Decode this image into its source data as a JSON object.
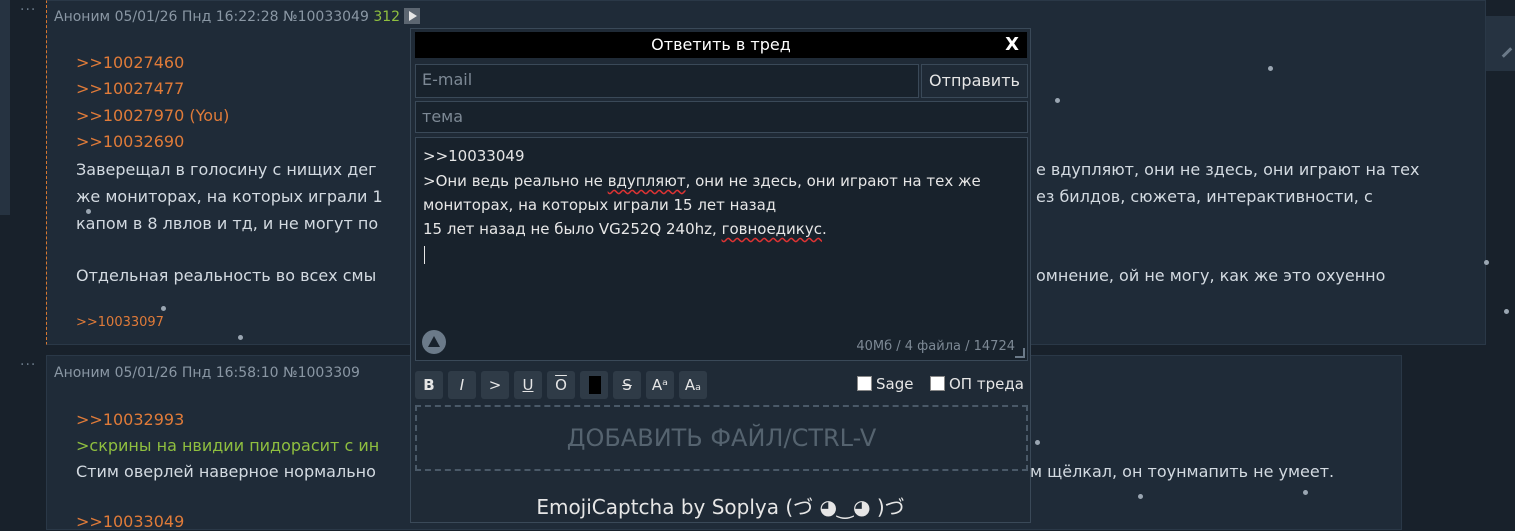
{
  "post1": {
    "author": "Аноним",
    "datetime": "05/01/26 Пнд 16:22:28",
    "number": "№10033049",
    "count": "312",
    "lines": [
      {
        "cls": "reply",
        "text": ">>10027460"
      },
      {
        "cls": "reply",
        "text": ">>10027477"
      },
      {
        "cls": "reply",
        "text": ">>10027970 (You)"
      },
      {
        "cls": "reply",
        "text": ">>10032690"
      }
    ],
    "body_line1_left": "Заверещал в голосину с нищих дег",
    "body_line1_right": "е вдупляют, они не здесь, они играют на тех",
    "body_line2_left": "же мониторах, на которых играли 1",
    "body_line2_right": "ез билдов, сюжета, интерактивности, с",
    "body_line3_left": "капом в 8 лвлов и тд, и не могут по",
    "body_line4_left": "Отдельная реальность во всех смы",
    "body_line4_right": "омнение, ой не могу, как же это охуенно",
    "backlink": ">>10033097"
  },
  "post2": {
    "author": "Аноним",
    "datetime": "05/01/26 Пнд 16:58:10",
    "number": "№1003309",
    "reply": ">>10032993",
    "greentext": ">скрины на нвидии пидорасит с ин",
    "body_left": "Стим оверлей наверное нормально",
    "body_right": "м щёлкал, он тоунмапить не умеет.",
    "partial": ">>10033049"
  },
  "modal": {
    "title": "Ответить в тред",
    "close": "X",
    "email_placeholder": "E-mail",
    "send_label": "Отправить",
    "subject_placeholder": "тема",
    "text_line1": ">>10033049",
    "text_line2a": ">Они ведь реально не ",
    "text_line2b": "вдупляют",
    "text_line2c": ", они не здесь, они играют на тех же",
    "text_line3": "мониторах, на которых играли 15 лет назад",
    "text_line4a": "15 лет назад не было VG252Q 240hz, ",
    "text_line4b": "говноедикус",
    "text_line4c": ".",
    "limits": "40Мб / 4 файла / 14724",
    "toolbar": [
      "B",
      "I",
      ">",
      "U",
      "O",
      "",
      "S",
      "Aᵃ",
      "Aₐ"
    ],
    "sage_label": "Sage",
    "op_label": "ОП треда",
    "dropzone_label": "ДОБАВИТЬ ФАЙЛ/CTRL-V",
    "captcha_label": "EmojiCaptcha by Soplya (づ ◕‿◕ )づ"
  },
  "colors": {
    "background": "#18212b",
    "post": "#1f2b38",
    "reply": "#e07b39",
    "greentext": "#8fbf3f"
  }
}
